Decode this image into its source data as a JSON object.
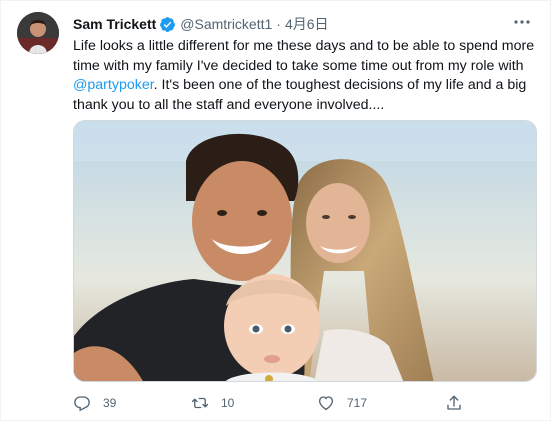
{
  "tweet": {
    "author_name": "Sam Trickett",
    "handle": "@Samtrickett1",
    "separator": "·",
    "date": "4月6日",
    "text_before": "Life looks a little different for me these days and to be able to spend more time with my family I've decided to take some time out from my role with ",
    "mention": "@partypoker",
    "text_after": ". It's been one of the toughest decisions of my life and a big thank you to all the staff and everyone involved....",
    "verified_icon": "verified-badge-icon",
    "media_description": "photo"
  },
  "actions": {
    "reply": {
      "icon": "reply-icon",
      "count": "39"
    },
    "retweet": {
      "icon": "retweet-icon",
      "count": "10"
    },
    "like": {
      "icon": "like-icon",
      "count": "717"
    },
    "share": {
      "icon": "share-icon"
    }
  },
  "colors": {
    "accent": "#1d9bf0",
    "text_primary": "#0f1419",
    "text_secondary": "#536471"
  }
}
